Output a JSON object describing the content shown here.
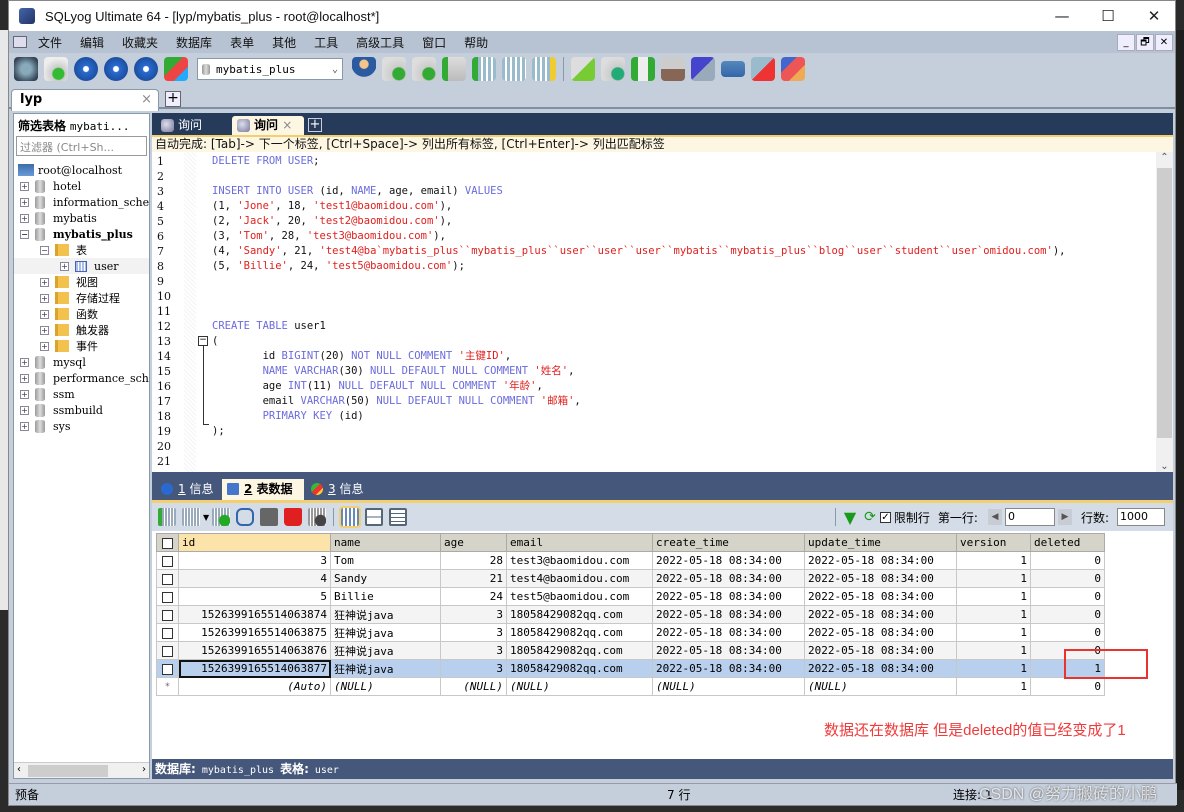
{
  "window": {
    "title": "SQLyog Ultimate 64 - [lyp/mybatis_plus - root@localhost*]",
    "minimize": "—",
    "maximize": "☐",
    "close": "✕",
    "mdi": {
      "minimize": "_",
      "restore": "🗗",
      "close": "✕"
    }
  },
  "menu": [
    "文件",
    "编辑",
    "收藏夹",
    "数据库",
    "表单",
    "其他",
    "工具",
    "高级工具",
    "窗口",
    "帮助"
  ],
  "toolbar": {
    "database_select": "mybatis_plus",
    "icons_left": [
      "new-connection-icon",
      "new-query-icon",
      "execute-query-icon",
      "execute-all-icon",
      "execute-edit-icon",
      "schema-designer-icon"
    ],
    "icons_right": [
      "user-manager-icon",
      "backup-db-icon",
      "restore-db-icon",
      "import-icon",
      "export-table-icon",
      "table-data-icon",
      "table-key-icon",
      "sql-check-icon",
      "db-sync-icon",
      "structure-compare-icon",
      "data-copy-icon",
      "query-builder-icon",
      "job-agent-icon",
      "table-diff-icon",
      "schema-diagram-icon"
    ]
  },
  "connection_tab": {
    "label": "lyp",
    "close": "×",
    "add": "+"
  },
  "sidebar": {
    "header": "筛选表格",
    "header_db": "mybati...",
    "filter_placeholder": "过滤器 (Ctrl+Sh...",
    "root": "root@localhost",
    "databases": [
      {
        "name": "hotel",
        "expanded": false
      },
      {
        "name": "information_sche",
        "expanded": false
      },
      {
        "name": "mybatis",
        "expanded": false
      },
      {
        "name": "mybatis_plus",
        "expanded": true,
        "bold": true
      },
      {
        "name": "mysql",
        "expanded": false
      },
      {
        "name": "performance_sche",
        "expanded": false
      },
      {
        "name": "ssm",
        "expanded": false
      },
      {
        "name": "ssmbuild",
        "expanded": false
      },
      {
        "name": "sys",
        "expanded": false
      }
    ],
    "mybatis_plus_children": [
      {
        "name": "表",
        "expanded": true,
        "children": [
          "user"
        ]
      },
      {
        "name": "视图"
      },
      {
        "name": "存储过程"
      },
      {
        "name": "函数"
      },
      {
        "name": "触发器"
      },
      {
        "name": "事件"
      }
    ]
  },
  "query_tabs": [
    {
      "label": "询问",
      "active": false
    },
    {
      "label": "询问",
      "active": true,
      "close": "×"
    }
  ],
  "query_add": "+",
  "autocomplete_hint": "自动完成: [Tab]-> 下一个标签, [Ctrl+Space]-> 列出所有标签, [Ctrl+Enter]-> 列出匹配标签",
  "editor": {
    "lines": [
      [
        [
          "kw",
          "DELETE FROM USER"
        ],
        [
          "pl",
          ";"
        ]
      ],
      [],
      [
        [
          "kw",
          "INSERT INTO USER "
        ],
        [
          "pl",
          "(id, "
        ],
        [
          "kw",
          "NAME"
        ],
        [
          "pl",
          ", age, email) "
        ],
        [
          "kw",
          "VALUES"
        ]
      ],
      [
        [
          "pl",
          "(1, "
        ],
        [
          "str",
          "'Jone'"
        ],
        [
          "pl",
          ", 18, "
        ],
        [
          "str",
          "'test1@baomidou.com'"
        ],
        [
          "pl",
          "),"
        ]
      ],
      [
        [
          "pl",
          "(2, "
        ],
        [
          "str",
          "'Jack'"
        ],
        [
          "pl",
          ", 20, "
        ],
        [
          "str",
          "'test2@baomidou.com'"
        ],
        [
          "pl",
          "),"
        ]
      ],
      [
        [
          "pl",
          "(3, "
        ],
        [
          "str",
          "'Tom'"
        ],
        [
          "pl",
          ", 28, "
        ],
        [
          "str",
          "'test3@baomidou.com'"
        ],
        [
          "pl",
          "),"
        ]
      ],
      [
        [
          "pl",
          "(4, "
        ],
        [
          "str",
          "'Sandy'"
        ],
        [
          "pl",
          ", 21, "
        ],
        [
          "str",
          "'test4@ba`mybatis_plus``mybatis_plus``user``user``user``mybatis``mybatis_plus``blog``user``student``user`omidou.com'"
        ],
        [
          "pl",
          "),"
        ]
      ],
      [
        [
          "pl",
          "(5, "
        ],
        [
          "str",
          "'Billie'"
        ],
        [
          "pl",
          ", 24, "
        ],
        [
          "str",
          "'test5@baomidou.com'"
        ],
        [
          "pl",
          ");"
        ]
      ],
      [],
      [],
      [],
      [
        [
          "kw",
          "CREATE TABLE "
        ],
        [
          "pl",
          "user1"
        ]
      ],
      [
        [
          "pl",
          "("
        ]
      ],
      [
        [
          "pl",
          "        id "
        ],
        [
          "kw",
          "BIGINT"
        ],
        [
          "pl",
          "(20) "
        ],
        [
          "kw",
          "NOT NULL COMMENT "
        ],
        [
          "str",
          "'主键ID'"
        ],
        [
          "pl",
          ","
        ]
      ],
      [
        [
          "pl",
          "        "
        ],
        [
          "kw",
          "NAME VARCHAR"
        ],
        [
          "pl",
          "(30) "
        ],
        [
          "kw",
          "NULL DEFAULT NULL COMMENT "
        ],
        [
          "str",
          "'姓名'"
        ],
        [
          "pl",
          ","
        ]
      ],
      [
        [
          "pl",
          "        age "
        ],
        [
          "kw",
          "INT"
        ],
        [
          "pl",
          "(11) "
        ],
        [
          "kw",
          "NULL DEFAULT NULL COMMENT "
        ],
        [
          "str",
          "'年龄'"
        ],
        [
          "pl",
          ","
        ]
      ],
      [
        [
          "pl",
          "        email "
        ],
        [
          "kw",
          "VARCHAR"
        ],
        [
          "pl",
          "(50) "
        ],
        [
          "kw",
          "NULL DEFAULT NULL COMMENT "
        ],
        [
          "str",
          "'邮箱'"
        ],
        [
          "pl",
          ","
        ]
      ],
      [
        [
          "pl",
          "        "
        ],
        [
          "kw",
          "PRIMARY KEY "
        ],
        [
          "pl",
          "(id)"
        ]
      ],
      [
        [
          "pl",
          ");"
        ]
      ],
      [],
      []
    ]
  },
  "result_tabs": [
    {
      "num": "1",
      "label": "信息",
      "active": false
    },
    {
      "num": "2",
      "label": "表数据",
      "active": true
    },
    {
      "num": "3",
      "label": "信息",
      "active": false
    }
  ],
  "result_toolbar": {
    "limit_rows_label": "限制行",
    "limit_rows_checked": true,
    "first_row_label": "第一行:",
    "first_row_value": "0",
    "rows_label": "行数:",
    "rows_value": "1000",
    "prev": "◀",
    "next": "▶"
  },
  "grid": {
    "columns": [
      "id",
      "name",
      "age",
      "email",
      "create_time",
      "update_time",
      "version",
      "deleted"
    ],
    "rows": [
      [
        "3",
        "Tom",
        "28",
        "test3@baomidou.com",
        "2022-05-18 08:34:00",
        "2022-05-18 08:34:00",
        "1",
        "0"
      ],
      [
        "4",
        "Sandy",
        "21",
        "test4@baomidou.com",
        "2022-05-18 08:34:00",
        "2022-05-18 08:34:00",
        "1",
        "0"
      ],
      [
        "5",
        "Billie",
        "24",
        "test5@baomidou.com",
        "2022-05-18 08:34:00",
        "2022-05-18 08:34:00",
        "1",
        "0"
      ],
      [
        "1526399165514063874",
        "狂神说java",
        "3",
        "18058429082qq.com",
        "2022-05-18 08:34:00",
        "2022-05-18 08:34:00",
        "1",
        "0"
      ],
      [
        "1526399165514063875",
        "狂神说java",
        "3",
        "18058429082qq.com",
        "2022-05-18 08:34:00",
        "2022-05-18 08:34:00",
        "1",
        "0"
      ],
      [
        "1526399165514063876",
        "狂神说java",
        "3",
        "18058429082qq.com",
        "2022-05-18 08:34:00",
        "2022-05-18 08:34:00",
        "1",
        "0"
      ],
      [
        "1526399165514063877",
        "狂神说java",
        "3",
        "18058429082qq.com",
        "2022-05-18 08:34:00",
        "2022-05-18 08:34:00",
        "1",
        "1"
      ]
    ],
    "selected_row": 6,
    "new_row": [
      "(Auto)",
      "(NULL)",
      "(NULL)",
      "(NULL)",
      "(NULL)",
      "(NULL)",
      "1",
      "0"
    ],
    "new_row_marker": "*"
  },
  "annotation": {
    "text": "数据还在数据库 但是deleted的值已经变成了1",
    "color": "#ef3b3b"
  },
  "infobar": {
    "db_label": "数据库:",
    "db": "mybatis_plus",
    "table_label": "表格:",
    "table": "user"
  },
  "statusbar": {
    "left": "预备",
    "rows": "7 行",
    "connections": "连接: 1",
    "watermark": "CSDN @努力搬砖的小鹏"
  }
}
